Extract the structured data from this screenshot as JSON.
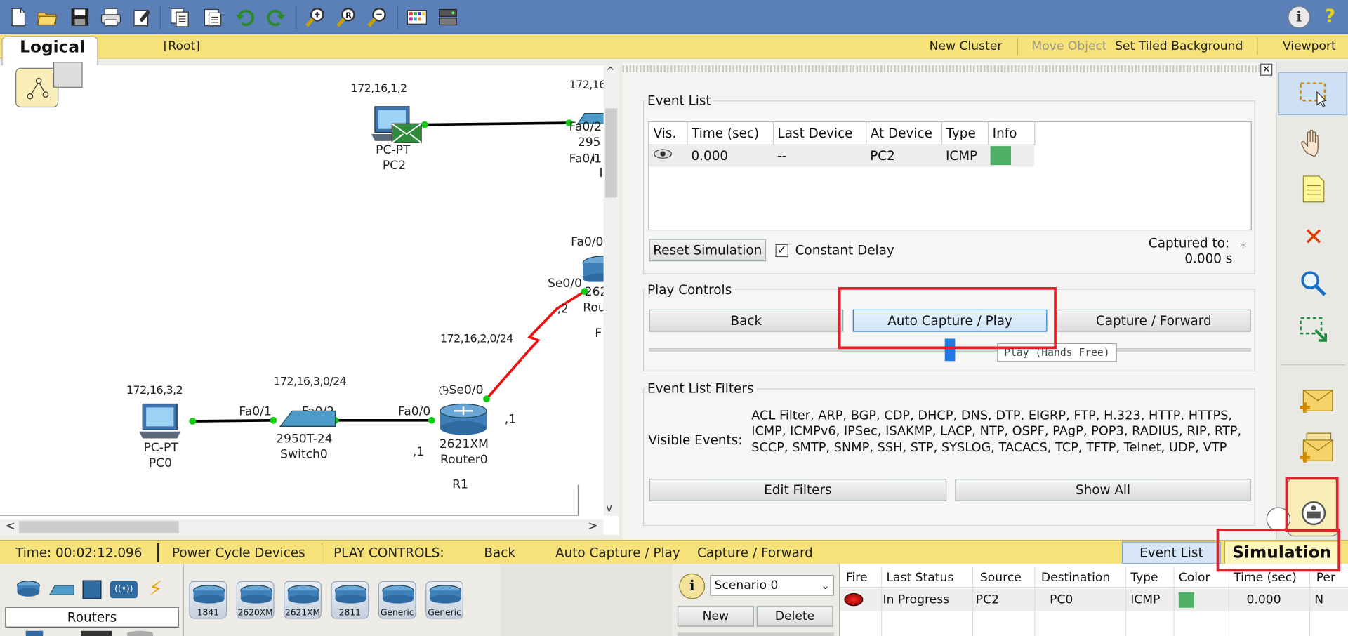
{
  "toolbar": {
    "help_icons": [
      "info-icon",
      "help-icon"
    ]
  },
  "logical_bar": {
    "tab": "Logical",
    "root": "[Root]",
    "new_cluster": "New Cluster",
    "move_object": "Move Object",
    "set_tiled_background": "Set Tiled Background",
    "viewport": "Viewport"
  },
  "canvas": {
    "pc2": {
      "ip": "172,16,1,2",
      "model": "PC-PT",
      "name": "PC2"
    },
    "pc0": {
      "ip": "172,16,3,2",
      "model": "PC-PT",
      "name": "PC0"
    },
    "switch0": {
      "network": "172,16,3,0/24",
      "model": "2950T-24",
      "name": "Switch0"
    },
    "router0": {
      "model": "2621XM",
      "name": "Router0",
      "hostname": "R1",
      "port_se": "Se0/0",
      "port_fa": "Fa0/0",
      "host_left": ",1",
      "host_right": ",1"
    },
    "switch_top": {
      "ip_partial": "172,16",
      "fa2": "Fa0/2",
      "num": "295",
      "fa1": "Fa0/1",
      "extra": "I"
    },
    "router_top": {
      "fa": "Fa0/0",
      "se": "Se0/0",
      "model_partial": "262",
      "name_partial": "Rou",
      "f": "F",
      "dot2": ",2"
    },
    "serial_network": "172,16,2,0/24",
    "port_fa01": "Fa0/1",
    "port_fa02": "Fa0/2",
    "port_fa00_sw": "Fa0/0"
  },
  "event_list": {
    "title": "Event List",
    "columns": [
      "Vis.",
      "Time (sec)",
      "Last Device",
      "At Device",
      "Type",
      "Info"
    ],
    "rows": [
      {
        "time": "0.000",
        "last_device": "--",
        "at_device": "PC2",
        "type": "ICMP",
        "info_color": "#4caf63"
      }
    ],
    "reset_button": "Reset Simulation",
    "constant_delay": "Constant Delay",
    "constant_delay_checked": true,
    "captured_label": "Captured to:",
    "captured_value": "0.000 s"
  },
  "play_controls": {
    "title": "Play Controls",
    "back": "Back",
    "auto_capture": "Auto Capture / Play",
    "capture_forward": "Capture / Forward",
    "tooltip": "Play (Hands Free)",
    "speed": 0.5
  },
  "filters": {
    "title": "Event List Filters",
    "visible_label": "Visible Events:",
    "events_text": "ACL Filter, ARP, BGP, CDP, DHCP, DNS, DTP, EIGRP, FTP, H.323, HTTP, HTTPS, ICMP, ICMPv6, IPSec, ISAKMP, LACP, NTP, OSPF, PAgP, POP3, RADIUS, RIP, RTP, SCCP, SMTP, SNMP, SSH, STP, SYSLOG, TACACS, TCP, TFTP, Telnet, UDP, VTP",
    "edit": "Edit Filters",
    "show_all": "Show All"
  },
  "status_bar": {
    "time": "Time: 00:02:12.096",
    "power_cycle": "Power Cycle Devices",
    "play_controls": "PLAY CONTROLS:",
    "back": "Back",
    "auto_capture": "Auto Capture / Play",
    "capture_forward": "Capture / Forward",
    "event_list": "Event List",
    "simulation": "Simulation"
  },
  "bottom": {
    "category": "Routers",
    "devices": [
      "1841",
      "2620XM",
      "2621XM",
      "2811",
      "Generic",
      "Generic"
    ],
    "scenario": "Scenario 0",
    "new": "New",
    "delete": "Delete",
    "pdu_columns": [
      "Fire",
      "Last Status",
      "Source",
      "Destination",
      "Type",
      "Color",
      "Time (sec)",
      "Per"
    ],
    "pdu_rows": [
      {
        "last_status": "In Progress",
        "source": "PC2",
        "destination": "PC0",
        "type": "ICMP",
        "color": "#4caf63",
        "time": "0.000",
        "periodic": "N"
      }
    ]
  }
}
